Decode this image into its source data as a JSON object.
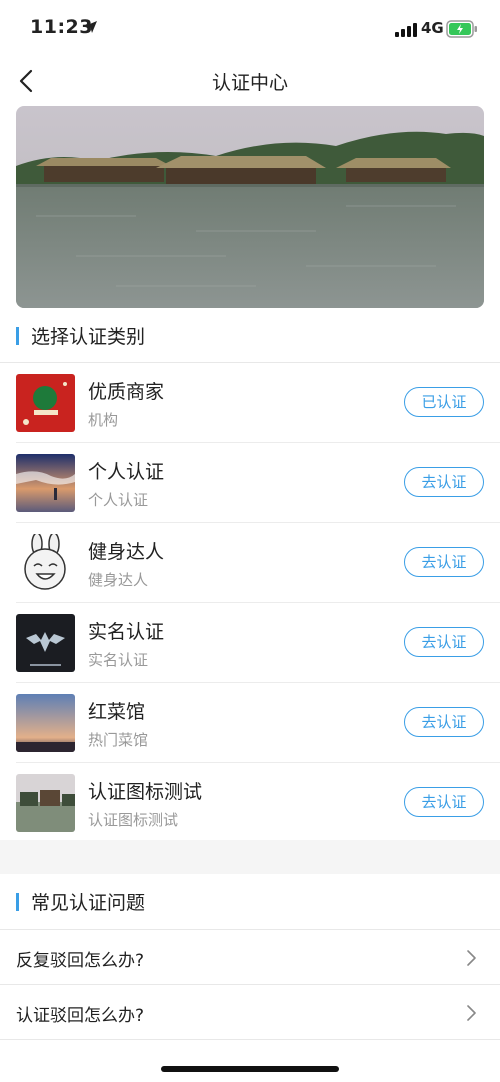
{
  "status": {
    "time": "11:23",
    "network": "4G"
  },
  "nav": {
    "title": "认证中心"
  },
  "section1": {
    "title": "选择认证类别"
  },
  "items": [
    {
      "name": "优质商家",
      "sub": "机构",
      "action": "已认证"
    },
    {
      "name": "个人认证",
      "sub": "个人认证",
      "action": "去认证"
    },
    {
      "name": "健身达人",
      "sub": "健身达人",
      "action": "去认证"
    },
    {
      "name": "实名认证",
      "sub": "实名认证",
      "action": "去认证"
    },
    {
      "name": "红菜馆",
      "sub": "热门菜馆",
      "action": "去认证"
    },
    {
      "name": "认证图标测试",
      "sub": "认证图标测试",
      "action": "去认证"
    }
  ],
  "section2": {
    "title": "常见认证问题"
  },
  "faq": [
    {
      "question": "反复驳回怎么办?"
    },
    {
      "question": "认证驳回怎么办?"
    }
  ],
  "colors": {
    "accent": "#3a9ee6",
    "subtext": "#999999",
    "background_gap": "#f5f5f5"
  }
}
